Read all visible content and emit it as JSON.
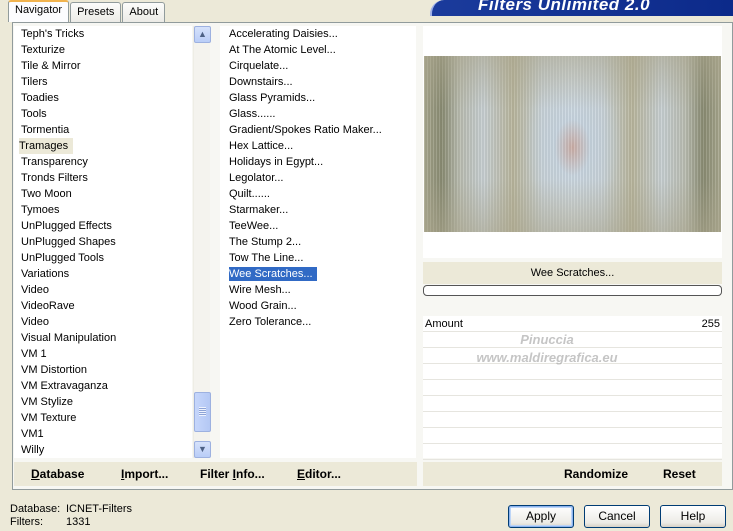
{
  "window": {
    "title": "Filters Unlimited 2.0"
  },
  "tabs": [
    {
      "label": "Navigator",
      "active": true
    },
    {
      "label": "Presets",
      "active": false
    },
    {
      "label": "About",
      "active": false
    }
  ],
  "categories": {
    "items": [
      "Teph's Tricks",
      "Texturize",
      "Tile & Mirror",
      "Tilers",
      "Toadies",
      "Tools",
      "Tormentia",
      "Tramages",
      "Transparency",
      "Tronds Filters",
      "Two Moon",
      "Tymoes",
      "UnPlugged Effects",
      "UnPlugged Shapes",
      "UnPlugged Tools",
      "Variations",
      "Video",
      "VideoRave",
      "Video",
      "Visual Manipulation",
      "VM 1",
      "VM Distortion",
      "VM Extravaganza",
      "VM Stylize",
      "VM Texture",
      "VM1",
      "Willy"
    ],
    "selected": "Tramages"
  },
  "filters": {
    "items": [
      "Accelerating Daisies...",
      "At The Atomic Level...",
      "Cirquelate...",
      "Downstairs...",
      "Glass Pyramids...",
      "Glass......",
      "Gradient/Spokes Ratio Maker...",
      "Hex Lattice...",
      "Holidays in Egypt...",
      "Legolator...",
      "Quilt......",
      "Starmaker...",
      "TeeWee...",
      "The Stump 2...",
      "Tow The Line...",
      "Wee Scratches...",
      "Wire Mesh...",
      "Wood Grain...",
      "Zero Tolerance..."
    ],
    "selected": "Wee Scratches..."
  },
  "preview": {
    "filter_name": "Wee Scratches...",
    "progress": 0
  },
  "parameters": [
    {
      "name": "Amount",
      "value": "255"
    }
  ],
  "watermark": {
    "line1": "Pinuccia",
    "line2": "www.maldiregrafica.eu"
  },
  "left_buttons": {
    "database": {
      "pre": "",
      "u": "D",
      "post": "atabase"
    },
    "import": {
      "pre": "",
      "u": "I",
      "post": "mport..."
    },
    "filter_info": {
      "pre": "Filter ",
      "u": "I",
      "post": "nfo..."
    },
    "editor": {
      "pre": "",
      "u": "E",
      "post": "ditor..."
    }
  },
  "right_buttons": {
    "randomize": "Randomize",
    "reset": "Reset"
  },
  "status": {
    "database_label": "Database:",
    "database_value": "ICNET-Filters",
    "filters_label": "Filters:",
    "filters_value": "1331"
  },
  "dialog_buttons": {
    "apply": "Apply",
    "cancel": "Cancel",
    "help": "Help"
  }
}
